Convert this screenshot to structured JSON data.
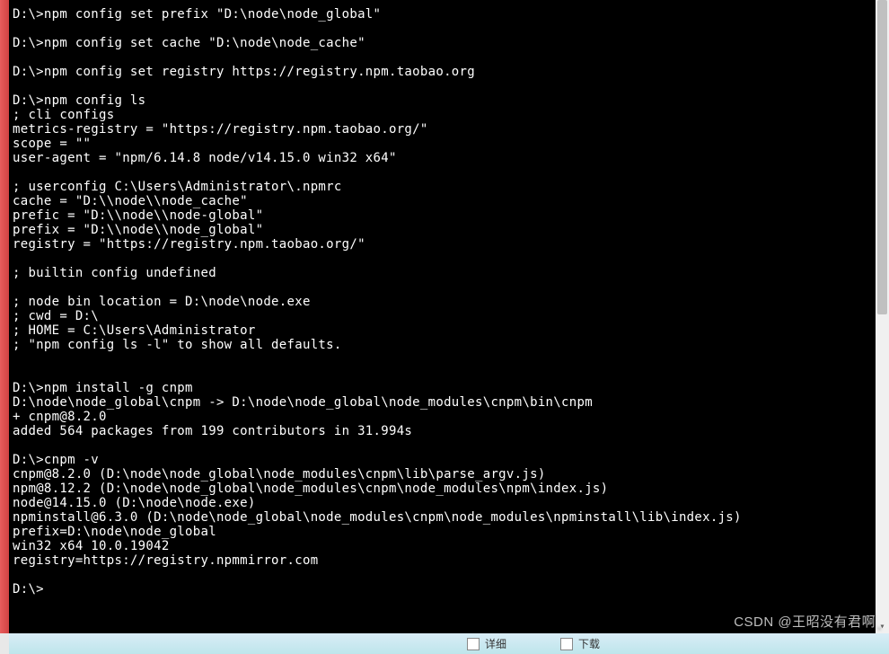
{
  "terminal": {
    "lines": [
      "D:\\>npm config set prefix \"D:\\node\\node_global\"",
      "",
      "D:\\>npm config set cache \"D:\\node\\node_cache\"",
      "",
      "D:\\>npm config set registry https://registry.npm.taobao.org",
      "",
      "D:\\>npm config ls",
      "; cli configs",
      "metrics-registry = \"https://registry.npm.taobao.org/\"",
      "scope = \"\"",
      "user-agent = \"npm/6.14.8 node/v14.15.0 win32 x64\"",
      "",
      "; userconfig C:\\Users\\Administrator\\.npmrc",
      "cache = \"D:\\\\node\\\\node_cache\"",
      "prefic = \"D:\\\\node\\\\node-global\"",
      "prefix = \"D:\\\\node\\\\node_global\"",
      "registry = \"https://registry.npm.taobao.org/\"",
      "",
      "; builtin config undefined",
      "",
      "; node bin location = D:\\node\\node.exe",
      "; cwd = D:\\",
      "; HOME = C:\\Users\\Administrator",
      "; \"npm config ls -l\" to show all defaults.",
      "",
      "",
      "D:\\>npm install -g cnpm",
      "D:\\node\\node_global\\cnpm -> D:\\node\\node_global\\node_modules\\cnpm\\bin\\cnpm",
      "+ cnpm@8.2.0",
      "added 564 packages from 199 contributors in 31.994s",
      "",
      "D:\\>cnpm -v",
      "cnpm@8.2.0 (D:\\node\\node_global\\node_modules\\cnpm\\lib\\parse_argv.js)",
      "npm@8.12.2 (D:\\node\\node_global\\node_modules\\cnpm\\node_modules\\npm\\index.js)",
      "node@14.15.0 (D:\\node\\node.exe)",
      "npminstall@6.3.0 (D:\\node\\node_global\\node_modules\\cnpm\\node_modules\\npminstall\\lib\\index.js)",
      "prefix=D:\\node\\node_global",
      "win32 x64 10.0.19042",
      "registry=https://registry.npmmirror.com",
      "",
      "D:\\>"
    ]
  },
  "taskbar": {
    "item1": "详细",
    "item2": "下载"
  },
  "watermark": {
    "text": "CSDN @王昭没有君啊"
  }
}
